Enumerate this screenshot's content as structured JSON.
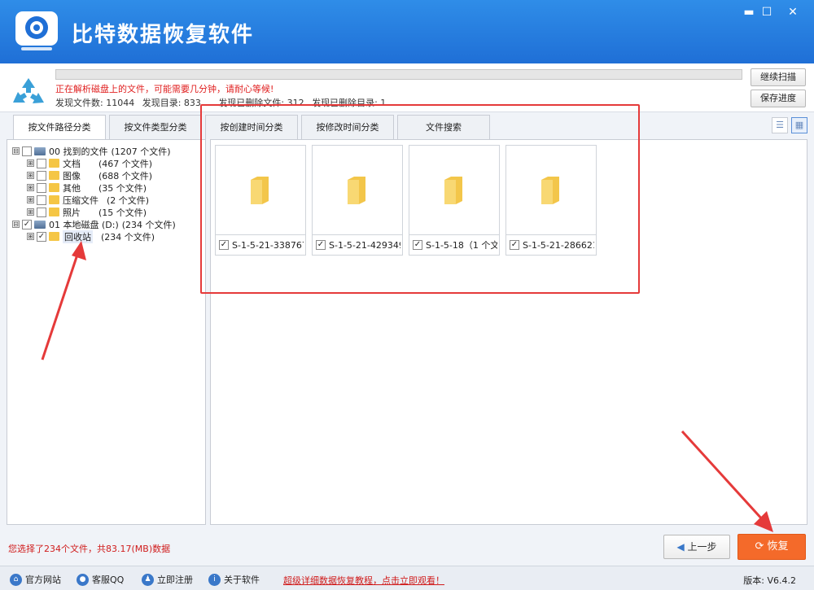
{
  "app": {
    "title": "比特数据恢复软件"
  },
  "window_controls": {
    "minimize": "▬",
    "maximize": "☐",
    "close": "✕"
  },
  "scan": {
    "progress": 0,
    "warning": "正在解析磁盘上的文件，可能需要几分钟，请耐心等候!",
    "stats": [
      "发现文件数: 11044",
      "发现目录: 833",
      "发现已删除文件: 312",
      "发现已删除目录: 1"
    ],
    "continue_btn": "继续扫描",
    "save_btn": "保存进度"
  },
  "tabs": [
    "按文件路径分类",
    "按文件类型分类",
    "按创建时间分类",
    "按修改时间分类",
    "文件搜索"
  ],
  "view_icons": [
    "list-view-icon",
    "grid-view-icon"
  ],
  "tree": [
    {
      "expander": "⊟",
      "checked": false,
      "icon": "drive",
      "label": "00 找到的文件",
      "count": "(1207 个文件)"
    },
    {
      "expander": "⊞",
      "checked": false,
      "icon": "folder",
      "label": "文档",
      "count": "(467 个文件)"
    },
    {
      "expander": "⊞",
      "checked": false,
      "icon": "folder",
      "label": "图像",
      "count": "(688 个文件)"
    },
    {
      "expander": "⊞",
      "checked": false,
      "icon": "folder",
      "label": "其他",
      "count": "(35 个文件)"
    },
    {
      "expander": "⊞",
      "checked": false,
      "icon": "folder",
      "label": "压缩文件",
      "count": "(2 个文件)"
    },
    {
      "expander": "⊞",
      "checked": false,
      "icon": "folder",
      "label": "照片",
      "count": "(15 个文件)"
    },
    {
      "expander": "⊟",
      "checked": true,
      "icon": "drive",
      "label": "01 本地磁盘 (D:)",
      "count": "(234 个文件)"
    },
    {
      "expander": "⊞",
      "checked": true,
      "icon": "folder",
      "label": "回收站",
      "count": "(234 个文件)"
    }
  ],
  "files": [
    {
      "label": "S-1-5-21-338767...",
      "checked": true
    },
    {
      "label": "S-1-5-21-429349...",
      "checked": true
    },
    {
      "label": "S-1-5-18（1 个文...",
      "checked": true
    },
    {
      "label": "S-1-5-21-286621...",
      "checked": true
    }
  ],
  "bottom": {
    "selection_info": "您选择了234个文件，共83.17(MB)数据",
    "prev_btn": "上一步",
    "recover_btn": "恢复"
  },
  "footer": {
    "links": [
      "官方网站",
      "客服QQ",
      "立即注册",
      "关于软件"
    ],
    "promo": "超级详细数据恢复教程，点击立即观看！",
    "version": "版本: V6.4.2"
  },
  "colors": {
    "brand_blue": "#1f6fd6",
    "recover_orange": "#f46a2a",
    "annotation_red": "#e53a3a",
    "warning_red": "#e02020"
  }
}
